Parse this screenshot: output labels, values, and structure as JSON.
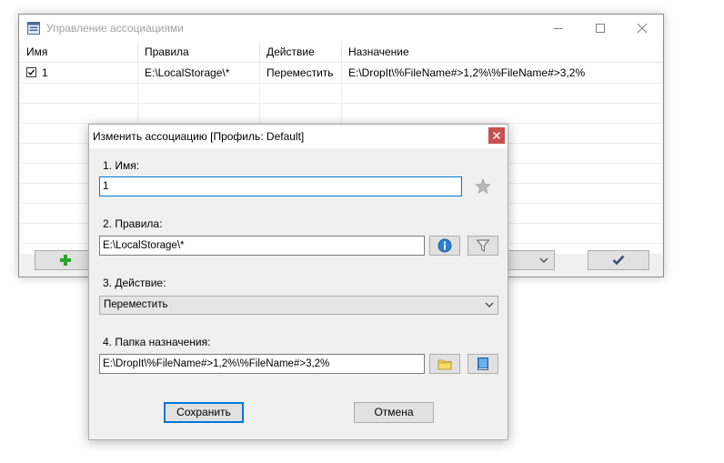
{
  "main_window": {
    "title": "Управление ассоциациями",
    "columns": [
      "Имя",
      "Правила",
      "Действие",
      "Назначение"
    ],
    "rows": [
      {
        "checked": true,
        "name": "1",
        "rules": "E:\\LocalStorage\\*",
        "action": "Переместить",
        "destination": "E:\\DropIt\\%FileName#>1,2%\\%FileName#>3,2%"
      }
    ],
    "icons": {
      "app": "app-window-icon",
      "add": "plus-icon",
      "dropdown": "chevron-down-icon",
      "ok": "checkmark-icon"
    },
    "colors": {
      "add_icon": "#2aa52a",
      "ok_icon": "#3b4f7a"
    }
  },
  "dialog": {
    "title": "Изменить ассоциацию [Профиль: Default]",
    "name_label": "1. Имя:",
    "name_value": "1",
    "rules_label": "2. Правила:",
    "rules_value": "E:\\LocalStorage\\*",
    "action_label": "3. Действие:",
    "action_value": "Переместить",
    "destination_label": "4. Папка назначения:",
    "destination_value": "E:\\DropIt\\%FileName#>1,2%\\%FileName#>3,2%",
    "save_label": "Сохранить",
    "cancel_label": "Отмена",
    "icons": {
      "favorite": "star-icon",
      "info": "info-icon",
      "filter": "filter-icon",
      "browse": "folder-icon",
      "book": "book-icon",
      "close": "close-icon"
    },
    "colors": {
      "close_bg": "#c75050",
      "focus": "#0078d7"
    }
  }
}
